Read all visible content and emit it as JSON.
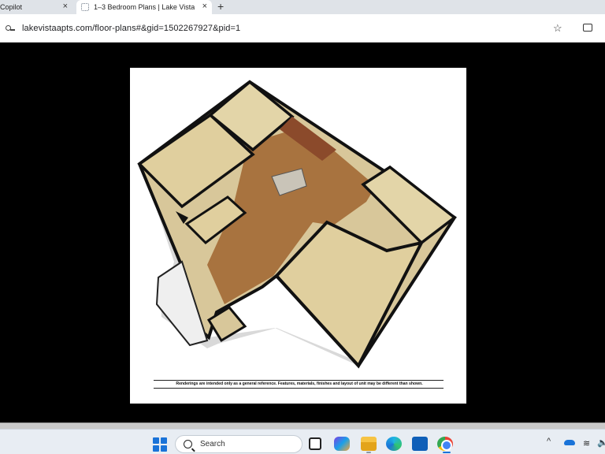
{
  "browser": {
    "tabs": [
      {
        "label": "Copilot",
        "close": "×"
      },
      {
        "label": "1–3 Bedroom Plans | Lake Vista",
        "close": "×"
      }
    ],
    "new_tab": "+",
    "url": "lakevistaapts.com/floor-plans#&gid=1502267927&pid=1",
    "star": "☆"
  },
  "content": {
    "disclaimer": "Renderings are intended only as a general reference. Features, materials, finishes and layout of unit may be different than shown."
  },
  "taskbar": {
    "search_placeholder": "Search",
    "tray_chevron": "^",
    "wifi": "≋",
    "speaker": "🔈",
    "colors": {
      "accent": "#1a73d8"
    }
  }
}
